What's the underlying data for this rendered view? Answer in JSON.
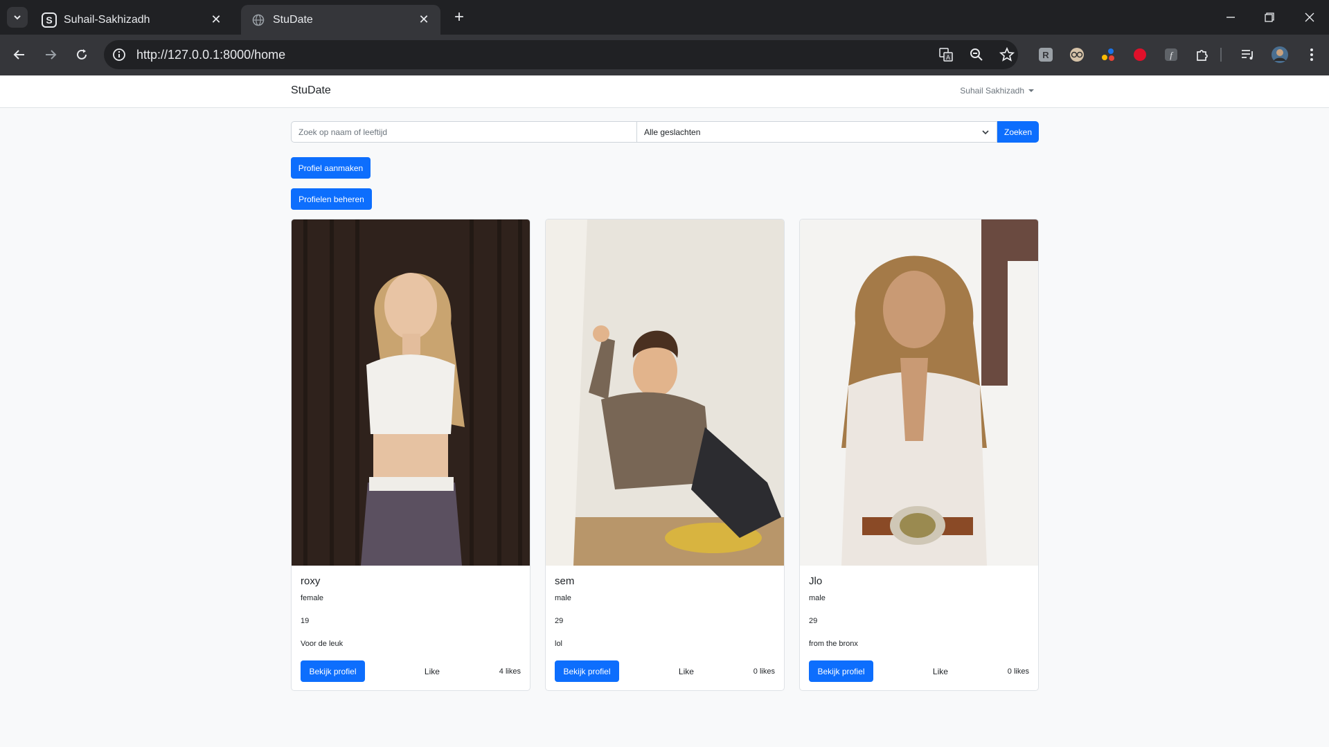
{
  "browser": {
    "tabs": [
      {
        "title": "Suhail-Sakhizadh",
        "favicon": "s-logo-icon",
        "active": false
      },
      {
        "title": "StuDate",
        "favicon": "globe-icon",
        "active": true
      }
    ],
    "url": "http://127.0.0.1:8000/home"
  },
  "navbar": {
    "brand": "StuDate",
    "user": "Suhail Sakhizadh"
  },
  "search": {
    "placeholder": "Zoek op naam of leeftijd",
    "gender_selected": "Alle geslachten",
    "button": "Zoeken"
  },
  "actions": {
    "create": "Profiel aanmaken",
    "manage": "Profielen beheren"
  },
  "profiles": [
    {
      "name": "roxy",
      "gender": "female",
      "age": "19",
      "bio": "Voor de leuk",
      "view": "Bekijk profiel",
      "like": "Like",
      "likes": "4 likes"
    },
    {
      "name": "sem",
      "gender": "male",
      "age": "29",
      "bio": "lol",
      "view": "Bekijk profiel",
      "like": "Like",
      "likes": "0 likes"
    },
    {
      "name": "Jlo",
      "gender": "male",
      "age": "29",
      "bio": "from the bronx",
      "view": "Bekijk profiel",
      "like": "Like",
      "likes": "0 likes"
    }
  ],
  "colors": {
    "primary": "#0d6efd",
    "chrome_dark": "#202124",
    "chrome_toolbar": "#35363a",
    "page_bg": "#f8f9fa"
  }
}
